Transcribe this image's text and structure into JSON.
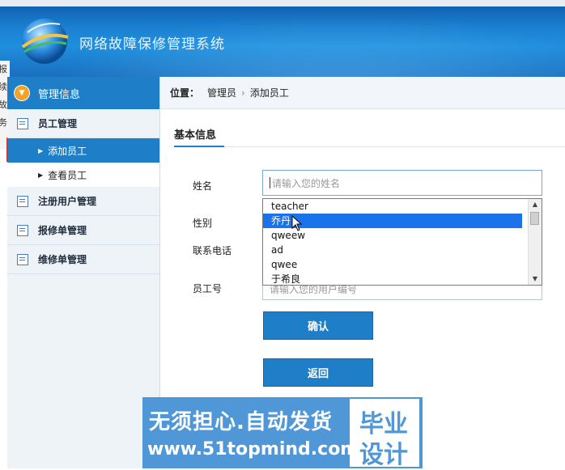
{
  "header": {
    "system_title": "网络故障保修管理系统"
  },
  "left_edge": {
    "chars": [
      "报",
      "续",
      "故",
      "务"
    ]
  },
  "sidebar": {
    "section_title": "管理信息",
    "groups": [
      {
        "label": "员工管理",
        "items": [
          {
            "label": "添加员工",
            "active": true
          },
          {
            "label": "查看员工",
            "active": false
          }
        ]
      },
      {
        "label": "注册用户管理"
      },
      {
        "label": "报修单管理"
      },
      {
        "label": "维修单管理"
      }
    ]
  },
  "breadcrumb": {
    "prefix": "位置：",
    "level1": "管理员",
    "level2": "添加员工"
  },
  "form": {
    "tab_label": "基本信息",
    "name_label": "姓名",
    "name_placeholder": "请输入您的姓名",
    "gender_label": "性别",
    "phone_label": "联系电话",
    "id_label": "员工号",
    "id_placeholder": "请输入您的用户编号",
    "confirm_label": "确认",
    "back_label": "返回"
  },
  "autocomplete": {
    "options": [
      "teacher",
      "乔丹",
      "qweew",
      "ad",
      "qwee",
      "于希良"
    ],
    "selected_index": 1
  },
  "watermark": {
    "line1": "无须担心.自动发货",
    "line2": "www.51topmind.com",
    "badge1": "毕业",
    "badge2": "设计"
  },
  "colors": {
    "accent": "#1f7ec8",
    "selected": "#1a73e8",
    "watermark": "#4f97d6"
  }
}
